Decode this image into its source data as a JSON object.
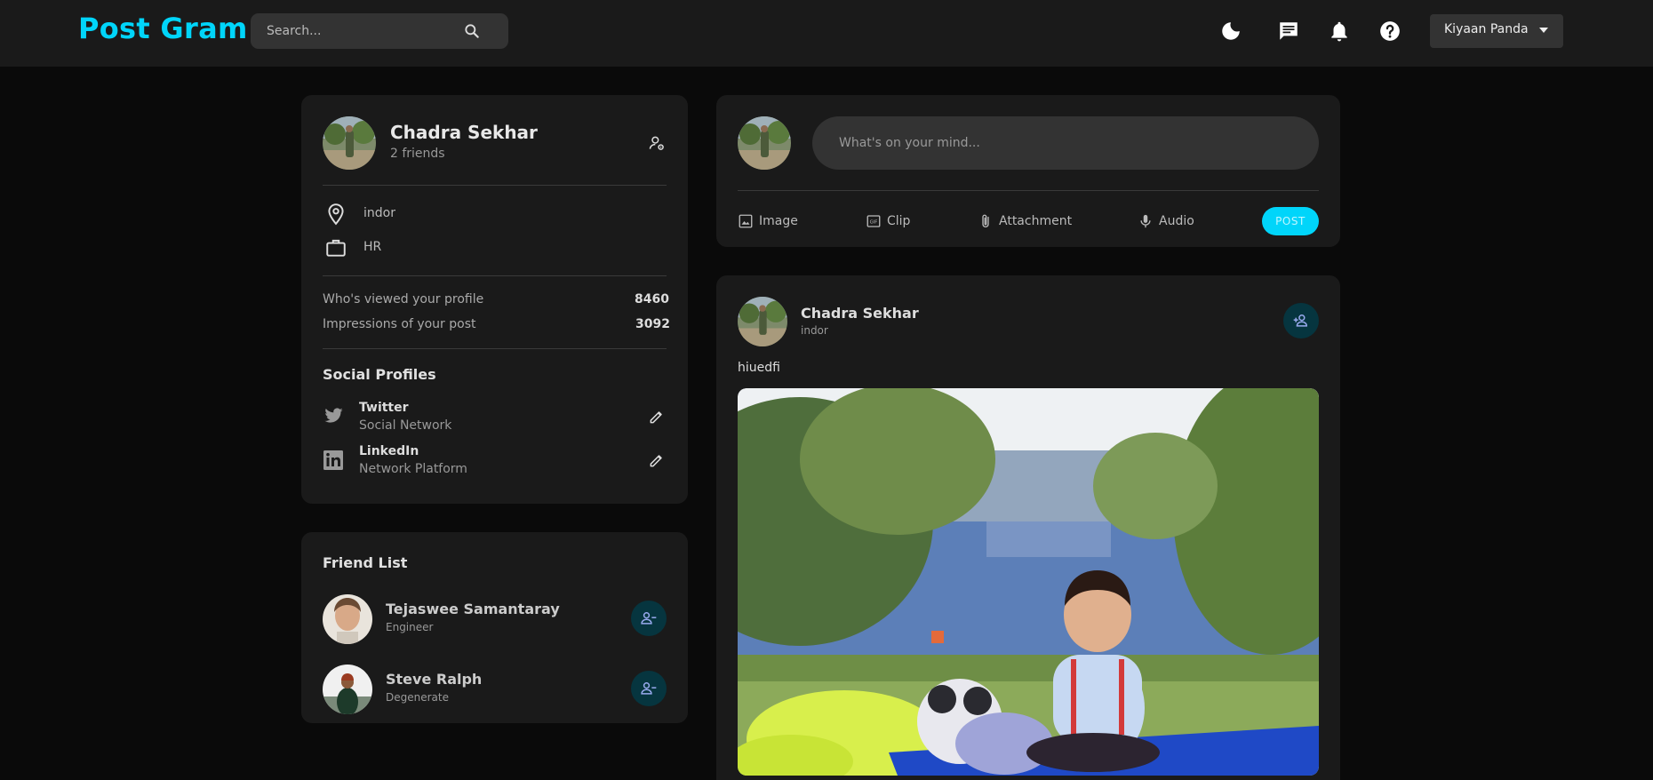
{
  "app": {
    "logo": "Post Gram"
  },
  "topbar": {
    "search_placeholder": "Search...",
    "user_name": "Kiyaan Panda",
    "icons": [
      "dark-mode-icon",
      "message-icon",
      "notification-icon",
      "help-icon"
    ]
  },
  "profile": {
    "name": "Chadra Sekhar",
    "friends": "2 friends",
    "location": "indor",
    "occupation": "HR",
    "viewed_label": "Who's viewed your profile",
    "viewed_value": "8460",
    "impressions_label": "Impressions of your post",
    "impressions_value": "3092",
    "social_title": "Social Profiles",
    "socials": [
      {
        "name": "Twitter",
        "desc": "Social Network"
      },
      {
        "name": "LinkedIn",
        "desc": "Network Platform"
      }
    ]
  },
  "friend_list": {
    "title": "Friend List",
    "friends": [
      {
        "name": "Tejaswee Samantaray",
        "occupation": "Engineer"
      },
      {
        "name": "Steve Ralph",
        "occupation": "Degenerate"
      }
    ]
  },
  "composer": {
    "placeholder": "What's on your mind...",
    "actions": [
      "Image",
      "Clip",
      "Attachment",
      "Audio"
    ],
    "post_label": "POST"
  },
  "post": {
    "author": "Chadra Sekhar",
    "location": "indor",
    "text": "hiuedfi"
  },
  "colors": {
    "accent": "#00d5fa",
    "background": "#0a0a0a",
    "card": "#1a1a1a"
  }
}
